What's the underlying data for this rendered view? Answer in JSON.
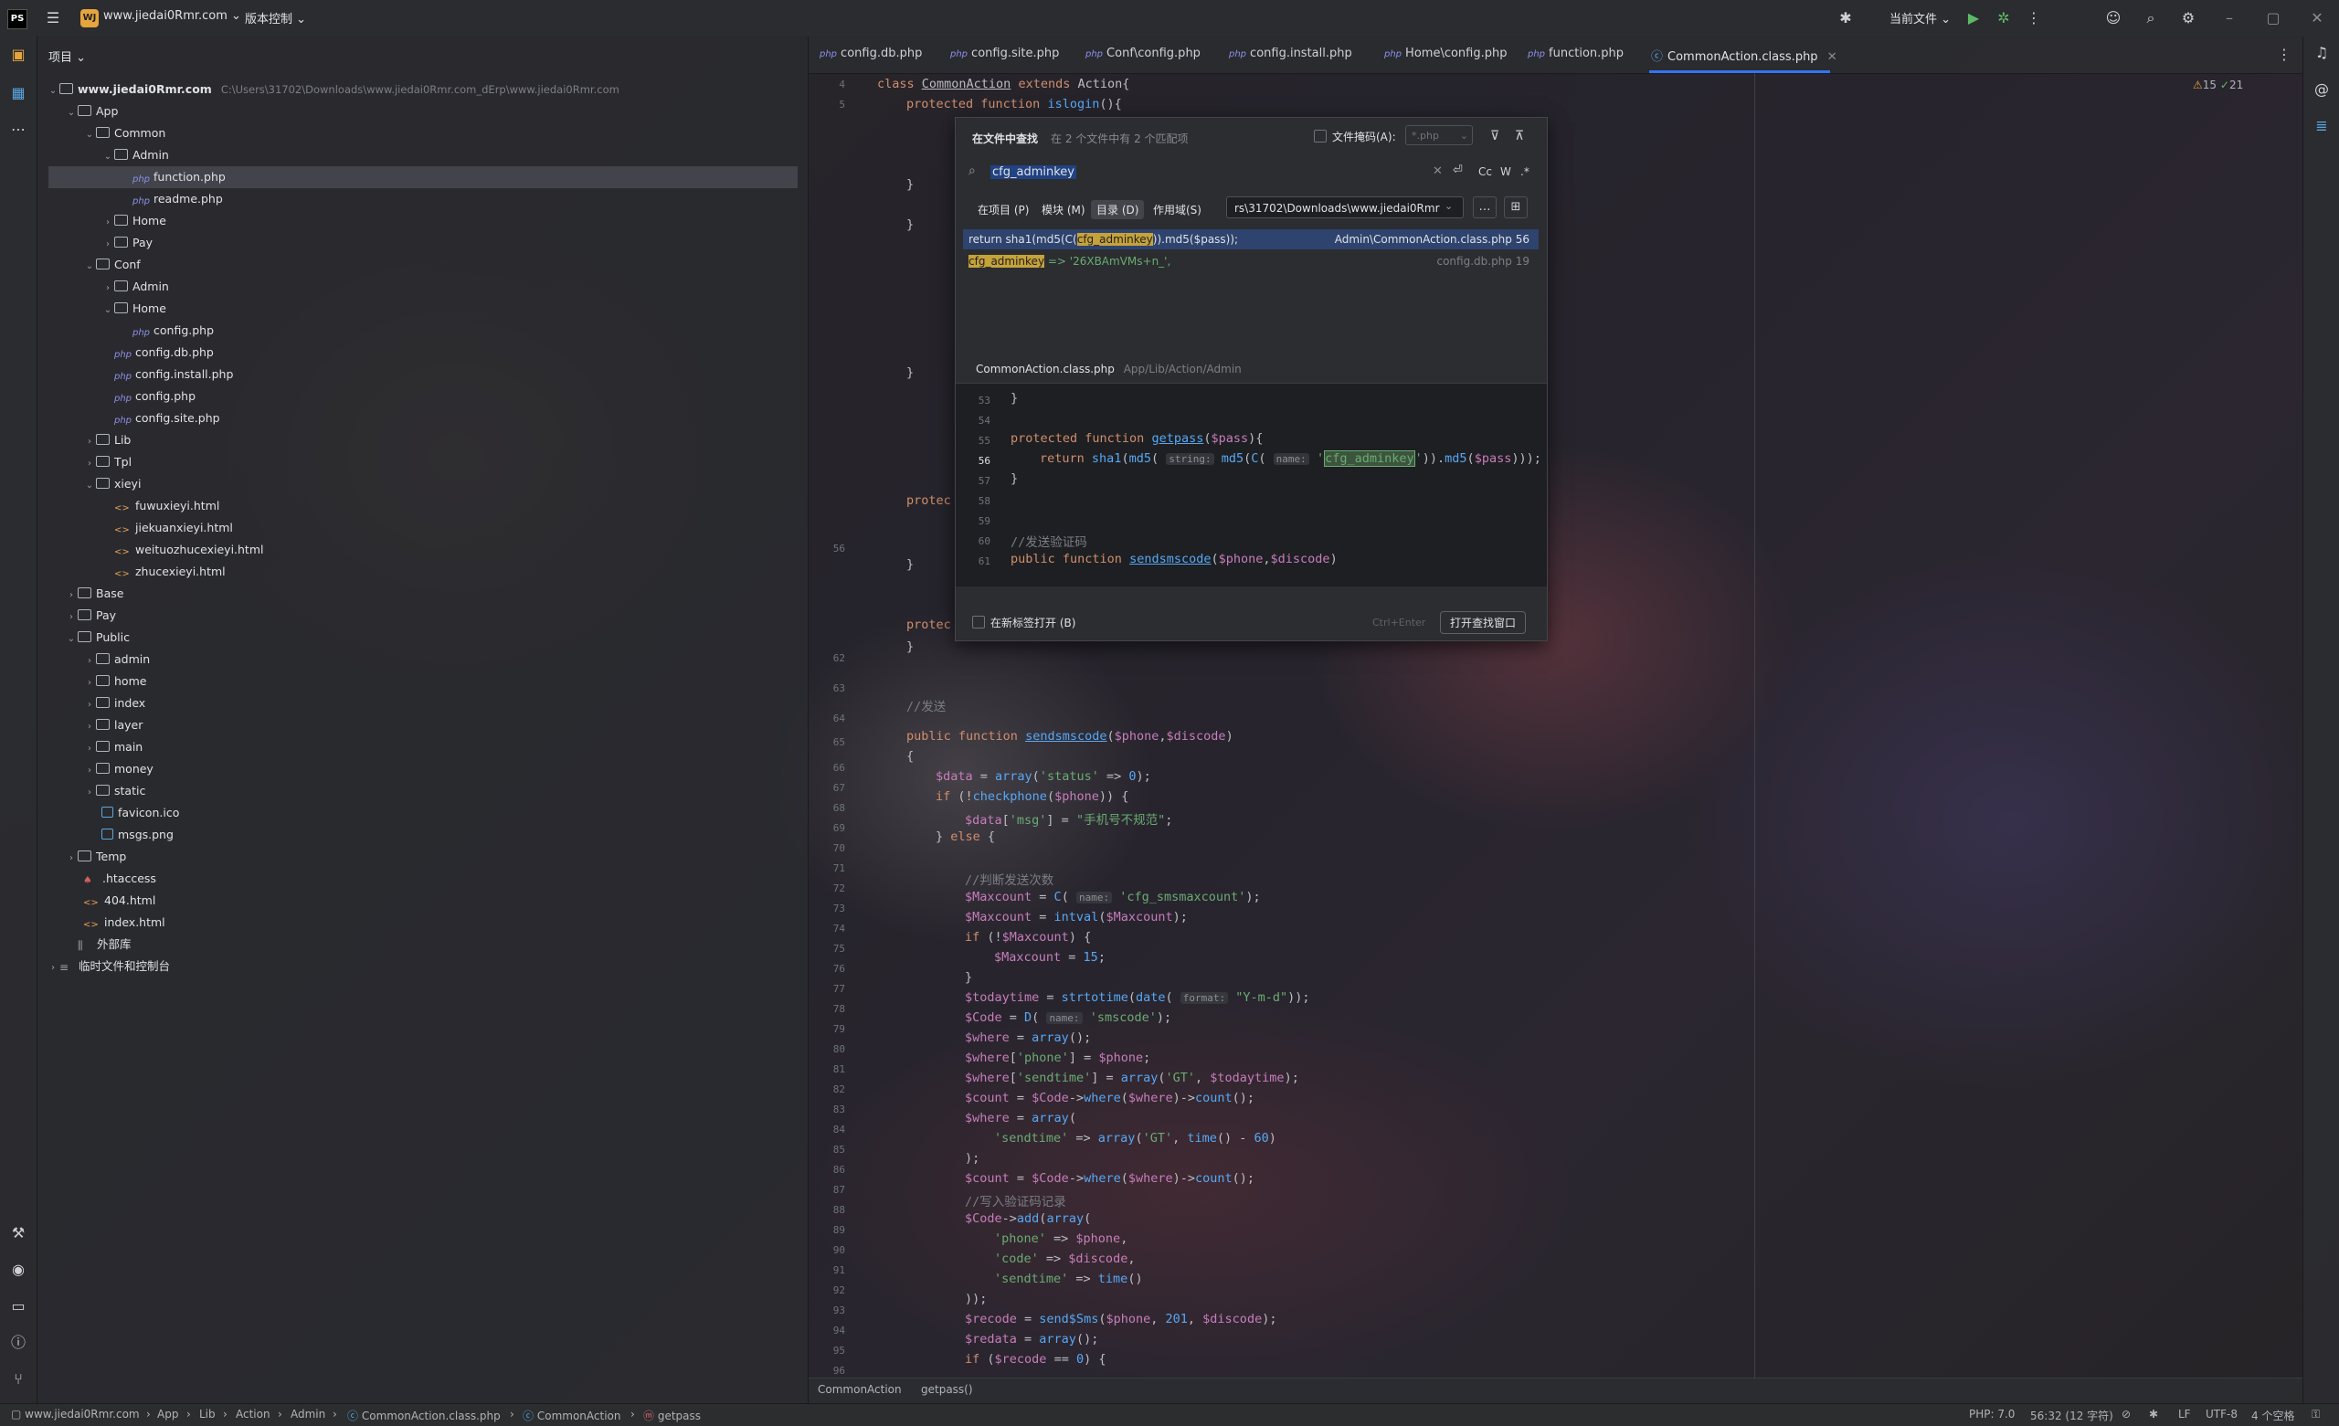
{
  "titlebar": {
    "logo": "PS",
    "project_badge": "WJ",
    "project_name": "www.jiedai0Rmr.com",
    "vcs": "版本控制",
    "run_config": "当前文件"
  },
  "project_panel": {
    "header": "项目",
    "root_name": "www.jiedai0Rmr.com",
    "root_path": "C:\\Users\\31702\\Downloads\\www.jiedai0Rmr.com_dErp\\www.jiedai0Rmr.com",
    "items": [
      {
        "label": "App"
      },
      {
        "label": "Common"
      },
      {
        "label": "Admin"
      },
      {
        "label": "function.php"
      },
      {
        "label": "readme.php"
      },
      {
        "label": "Home"
      },
      {
        "label": "Pay"
      },
      {
        "label": "Conf"
      },
      {
        "label": "Admin"
      },
      {
        "label": "Home"
      },
      {
        "label": "config.php"
      },
      {
        "label": "config.db.php"
      },
      {
        "label": "config.install.php"
      },
      {
        "label": "config.php"
      },
      {
        "label": "config.site.php"
      },
      {
        "label": "Lib"
      },
      {
        "label": "Tpl"
      },
      {
        "label": "xieyi"
      },
      {
        "label": "fuwuxieyi.html"
      },
      {
        "label": "jiekuanxieyi.html"
      },
      {
        "label": "weituozhucexieyi.html"
      },
      {
        "label": "zhucexieyi.html"
      },
      {
        "label": "Base"
      },
      {
        "label": "Pay"
      },
      {
        "label": "Public"
      },
      {
        "label": "admin"
      },
      {
        "label": "home"
      },
      {
        "label": "index"
      },
      {
        "label": "layer"
      },
      {
        "label": "main"
      },
      {
        "label": "money"
      },
      {
        "label": "static"
      },
      {
        "label": "favicon.ico"
      },
      {
        "label": "msgs.png"
      },
      {
        "label": "Temp"
      },
      {
        "label": ".htaccess"
      },
      {
        "label": "404.html"
      },
      {
        "label": "index.html"
      },
      {
        "label": "外部库"
      },
      {
        "label": "临时文件和控制台"
      }
    ]
  },
  "tabs": [
    {
      "label": "config.db.php"
    },
    {
      "label": "config.site.php"
    },
    {
      "label": "Conf\\config.php"
    },
    {
      "label": "config.install.php"
    },
    {
      "label": "Home\\config.php"
    },
    {
      "label": "function.php"
    },
    {
      "label": "CommonAction.class.php"
    }
  ],
  "inspections": {
    "warnings": "15",
    "ok": "21"
  },
  "find": {
    "title": "在文件中查找",
    "subtitle": "在 2 个文件中有 2 个匹配项",
    "file_mask_label": "文件掩码(A):",
    "file_mask_value": "*.php",
    "query": "cfg_adminkey",
    "scopes": [
      "在项目 (P)",
      "模块 (M)",
      "目录 (D)",
      "作用域(S)"
    ],
    "directory": "rs\\31702\\Downloads\\www.jiedai0Rmr",
    "options": {
      "cc": "Cc",
      "w": "W",
      "regex": ".*"
    },
    "results": [
      {
        "pre": "return sha1(md5(C(",
        "match": "cfg_adminkey",
        "post": ")).md5($pass));",
        "file": "Admin\\CommonAction.class.php 56"
      },
      {
        "pre": "",
        "match": "cfg_adminkey",
        "post": "  => '26XBAmVMs+n_',",
        "file": "config.db.php 19"
      }
    ],
    "preview_file": "CommonAction.class.php",
    "preview_path": "App/Lib/Action/Admin",
    "new_tab_label": "在新标签打开 (B)",
    "shortcut": "Ctrl+Enter",
    "open_window_button": "打开查找窗口"
  },
  "editor_breadcrumb": {
    "class": "CommonAction",
    "method": "getpass()"
  },
  "statusbar": {
    "crumbs": [
      "www.jiedai0Rmr.com",
      "App",
      "Lib",
      "Action",
      "Admin",
      "CommonAction.class.php",
      "CommonAction",
      "getpass"
    ],
    "php": "PHP: 7.0",
    "position": "56:32 (12 字符)",
    "line_sep": "LF",
    "encoding": "UTF-8",
    "indent": "4 个空格"
  }
}
